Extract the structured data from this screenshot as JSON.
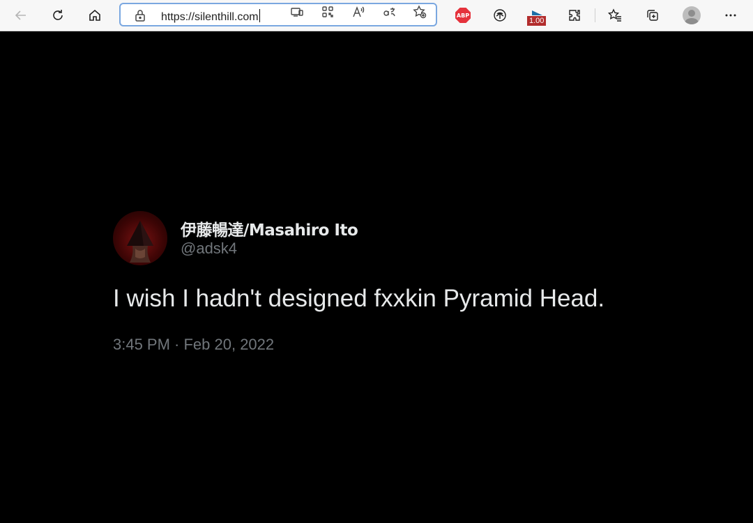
{
  "browser": {
    "url_host": "https://silenthill.com",
    "icons": {
      "back": "back-arrow-icon",
      "refresh": "refresh-icon",
      "home": "home-icon",
      "lock": "lock-icon",
      "app_available": "app-available-icon",
      "qr": "qr-code-icon",
      "read_aloud": "read-aloud-icon",
      "translate": "translate-icon",
      "add_favorite": "add-favorite-icon",
      "extensions": "extensions-icon",
      "favorites": "favorites-icon",
      "collections": "collections-icon",
      "profile": "profile-avatar-icon",
      "more": "more-menu-icon"
    },
    "extensions": {
      "adblock_label": "ABP",
      "speed_badge": "1.00"
    }
  },
  "tweet": {
    "display_name": "伊藤暢達/Masahiro Ito",
    "handle": "@adsk4",
    "text": "I wish I hadn't designed fxxkin Pyramid Head.",
    "timestamp": "3:45 PM · Feb 20, 2022"
  },
  "colors": {
    "page_bg": "#000000",
    "text_primary": "#e7e9ea",
    "text_secondary": "#71767b",
    "addr_focus": "#7aa7e0"
  }
}
